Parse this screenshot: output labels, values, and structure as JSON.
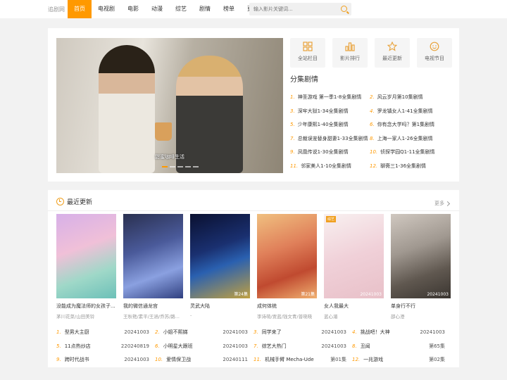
{
  "header": {
    "logo": "追剧网",
    "nav": [
      "首页",
      "电视剧",
      "电影",
      "动漫",
      "综艺",
      "剧情",
      "榜单"
    ],
    "more": "更多",
    "search_placeholder": "输入影片关键词..."
  },
  "hero": {
    "banner_caption": "甜蜜咖啡生活",
    "quick_links": [
      {
        "label": "全站栏目",
        "icon": "grid-icon"
      },
      {
        "label": "影片排行",
        "icon": "chart-icon"
      },
      {
        "label": "最近更新",
        "icon": "star-icon"
      },
      {
        "label": "电视节目",
        "icon": "smile-icon"
      }
    ],
    "episodes_title": "分集剧情",
    "episodes": [
      {
        "n": "1.",
        "t": "神圣游戏 第一季1-8全集剧情"
      },
      {
        "n": "2.",
        "t": "风云岁月第10集剧情"
      },
      {
        "n": "3.",
        "t": "深牢大狱1-34全集剧情"
      },
      {
        "n": "4.",
        "t": "罗龙镇女人1-41全集剧情"
      },
      {
        "n": "5.",
        "t": "少年康熙1-40全集剧情"
      },
      {
        "n": "6.",
        "t": "你有念大学吗？第1集剧情"
      },
      {
        "n": "7.",
        "t": "总裁误宠替身甜妻1-33全集剧情"
      },
      {
        "n": "8.",
        "t": "上海一家人1-26全集剧情"
      },
      {
        "n": "9.",
        "t": "凤凰传说1-30全集剧情"
      },
      {
        "n": "10.",
        "t": "侦探学园Q1-11全集剧情"
      },
      {
        "n": "11.",
        "t": "邻家美人1-10全集剧情"
      },
      {
        "n": "12.",
        "t": "聊斋三1-36全集剧情"
      }
    ]
  },
  "recent": {
    "title": "最近更新",
    "more": "更多",
    "cards": [
      {
        "title": "没能成为魔法师的女孩子...",
        "sub": "茅川花菜/山田美铃",
        "stamp": "",
        "tag": ""
      },
      {
        "title": "我的微信通龙宫",
        "sub": "王秋艳/素平/王涵/乔苏/路...",
        "stamp": "",
        "tag": ""
      },
      {
        "title": "灵武大陆",
        "sub": "-",
        "stamp": "第24集",
        "tag": ""
      },
      {
        "title": "成何体统",
        "sub": "李诗萌/贾蓝/钱文青/普晓晓",
        "stamp": "第21集",
        "tag": ""
      },
      {
        "title": "女人我最大",
        "sub": "蓝心湄",
        "stamp": "20241003",
        "tag": "综艺"
      },
      {
        "title": "单身行不行",
        "sub": "邵心澄",
        "stamp": "20241003",
        "tag": ""
      }
    ],
    "list": [
      {
        "n": "1.",
        "t": "型男大主厨",
        "v": "20241003"
      },
      {
        "n": "2.",
        "t": "小姐不熙娣",
        "v": "20241003"
      },
      {
        "n": "3.",
        "t": "同学来了",
        "v": "20241003"
      },
      {
        "n": "4.",
        "t": "挑战吧！大神",
        "v": "20241003"
      },
      {
        "n": "5.",
        "t": "11点热炒店",
        "v": "220240819"
      },
      {
        "n": "6.",
        "t": "小明星大跟班",
        "v": "20241003"
      },
      {
        "n": "7.",
        "t": "综艺大热门",
        "v": "20241003"
      },
      {
        "n": "8.",
        "t": "丑闻",
        "v": "第65集"
      },
      {
        "n": "9.",
        "t": "跨时代战书",
        "v": "20241003"
      },
      {
        "n": "10.",
        "t": "爱情保卫战",
        "v": "20240111"
      },
      {
        "n": "11.",
        "t": "机械手臂 Mecha-Ude",
        "v": "第01集"
      },
      {
        "n": "12.",
        "t": "一兆游戏",
        "v": "第02集"
      }
    ]
  }
}
